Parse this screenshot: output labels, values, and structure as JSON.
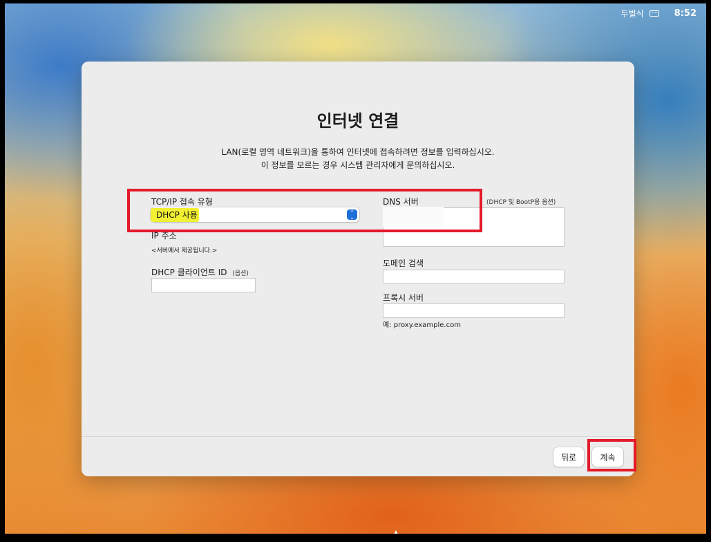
{
  "menubar": {
    "input_source": "두벌식",
    "time": "8:52"
  },
  "dialog": {
    "title": "인터넷 연결",
    "description_line1": "LAN(로컬 영역 네트워크)을 통하여 인터넷에 접속하려면 정보를 입력하십시오.",
    "description_line2": "이 정보를 모르는 경우 시스템 관리자에게 문의하십시오."
  },
  "tcpip": {
    "label": "TCP/IP 접속 유형",
    "selected_value": "DHCP 사용"
  },
  "ip_address": {
    "label": "IP 주소",
    "value": "<서버에서 제공됩니다.>"
  },
  "dhcp_client_id": {
    "label": "DHCP 클라이언트 ID",
    "optional": "(옵션)",
    "value": ""
  },
  "dns": {
    "label": "DNS 서버",
    "note": "(DHCP 및 BootP용 옵션)",
    "value": ""
  },
  "domain_search": {
    "label": "도메인 검색",
    "value": ""
  },
  "proxy": {
    "label": "프록시 서버",
    "value": "",
    "example": "예: proxy.example.com"
  },
  "buttons": {
    "back": "뒤로",
    "continue": "계속"
  },
  "colors": {
    "highlight_box": "#e31a2a",
    "text_highlight": "#f2f032",
    "accent": "#1f6fd8"
  }
}
